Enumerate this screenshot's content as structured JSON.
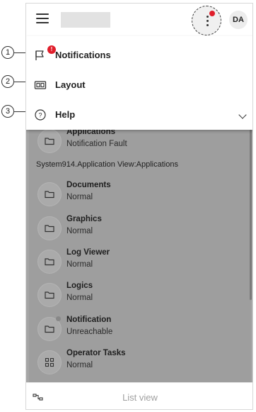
{
  "header": {
    "avatar_initials": "DA",
    "notification_badge_color": "#e01e2b"
  },
  "menu": {
    "items": [
      {
        "callout": "1",
        "icon": "notification-flag-icon",
        "label": "Notifications",
        "badge": "!"
      },
      {
        "callout": "2",
        "icon": "layout-icon",
        "label": "Layout"
      },
      {
        "callout": "3",
        "icon": "help-icon",
        "label": "Help",
        "expand_icon": "chevron-down-icon"
      }
    ]
  },
  "list": {
    "partial_item": {
      "title": "Applications",
      "status": "Notification Fault"
    },
    "group_header": "System914.Application View:Applications",
    "items": [
      {
        "title": "Documents",
        "status": "Normal",
        "icon": "folder-icon"
      },
      {
        "title": "Graphics",
        "status": "Normal",
        "icon": "folder-icon"
      },
      {
        "title": "Log Viewer",
        "status": "Normal",
        "icon": "folder-icon"
      },
      {
        "title": "Logics",
        "status": "Normal",
        "icon": "folder-icon"
      },
      {
        "title": "Notification",
        "status": "Unreachable",
        "icon": "folder-icon"
      },
      {
        "title": "Operator Tasks",
        "status": "Normal",
        "icon": "grid-icon"
      }
    ]
  },
  "bottom_bar": {
    "view_label": "List view",
    "left_icon": "tree-view-icon"
  }
}
